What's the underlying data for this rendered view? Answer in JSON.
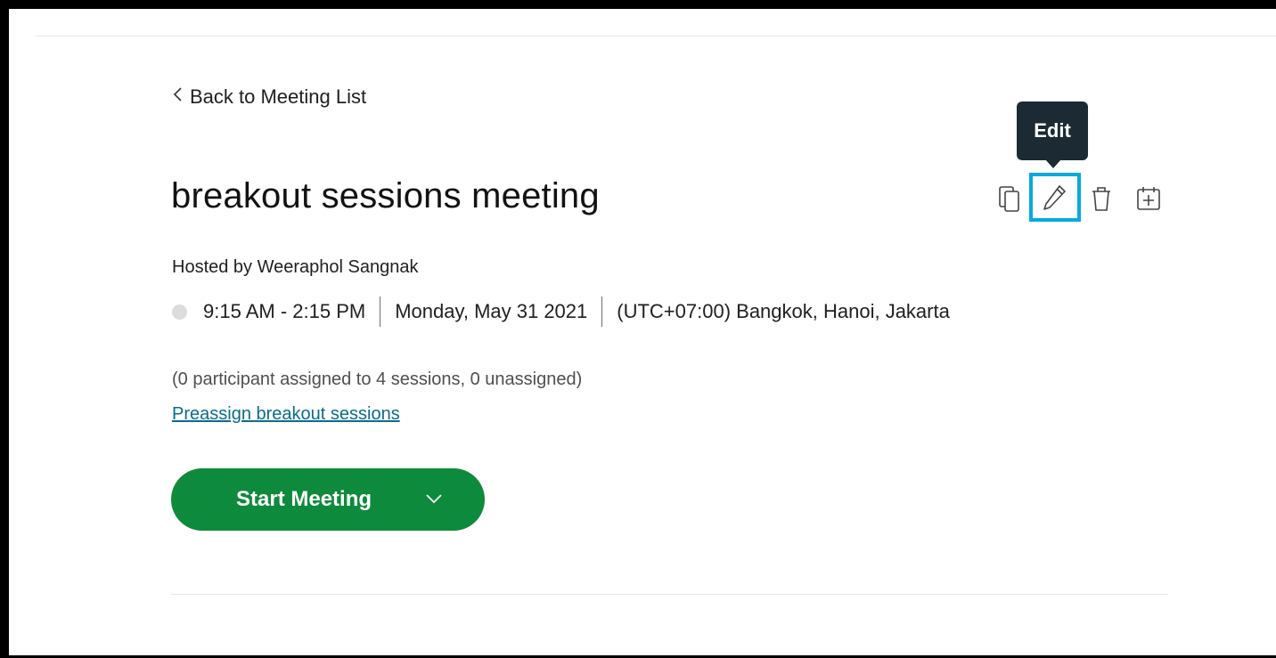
{
  "nav": {
    "back_label": "Back to Meeting List"
  },
  "meeting": {
    "title": "breakout sessions meeting",
    "hosted_by": "Hosted by Weeraphol Sangnak",
    "time_range": "9:15 AM - 2:15 PM",
    "date": "Monday, May 31 2021",
    "timezone": "(UTC+07:00) Bangkok, Hanoi, Jakarta",
    "assignment_summary": "(0 participant assigned to 4 sessions, 0 unassigned)",
    "preassign_link": "Preassign breakout sessions"
  },
  "actions": {
    "tooltip_label": "Edit",
    "icons": [
      "copy-icon",
      "pencil-icon",
      "trash-icon",
      "calendar-add-icon"
    ],
    "focus_color": "#08a9e0"
  },
  "start_button": {
    "label": "Start Meeting",
    "color": "#0e8a3c"
  },
  "colors": {
    "link": "#0a6c8a",
    "tooltip_bg": "#1b2a33"
  }
}
